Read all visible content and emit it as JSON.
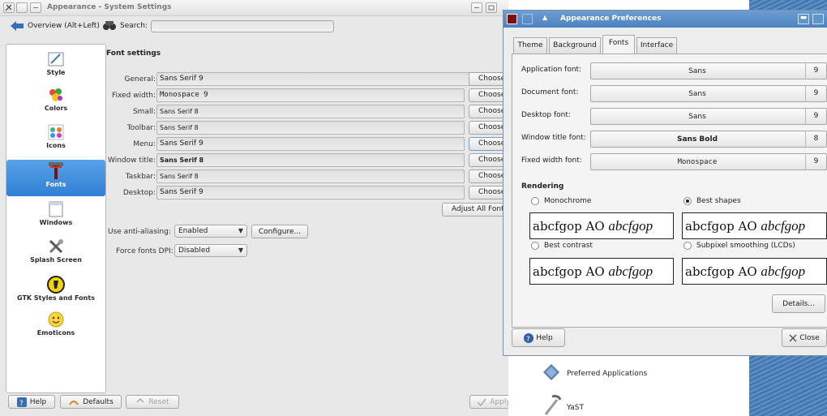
{
  "system_settings": {
    "window_title": "Appearance - System Settings",
    "toolbar": {
      "overview_label": "Overview (Alt+Left)",
      "search_label": "Search:",
      "search_value": ""
    },
    "sidebar": [
      {
        "label": "Style",
        "icon": "style-icon"
      },
      {
        "label": "Colors",
        "icon": "colors-icon"
      },
      {
        "label": "Icons",
        "icon": "icons-icon"
      },
      {
        "label": "Fonts",
        "icon": "fonts-icon",
        "selected": true
      },
      {
        "label": "Windows",
        "icon": "windows-icon"
      },
      {
        "label": "Splash Screen",
        "icon": "splash-screen-icon"
      },
      {
        "label": "GTK Styles and Fonts",
        "icon": "gtk-icon"
      },
      {
        "label": "Emoticons",
        "icon": "emoticons-icon"
      }
    ],
    "font_settings": {
      "title": "Font settings",
      "rows": [
        {
          "label": "General:",
          "value": "Sans Serif 9",
          "button": "Choose..."
        },
        {
          "label": "Fixed width:",
          "value": "Monospace 9",
          "button": "Choose..."
        },
        {
          "label": "Small:",
          "value": "Sans Serif 8",
          "button": "Choose..."
        },
        {
          "label": "Toolbar:",
          "value": "Sans Serif 8",
          "button": "Choose..."
        },
        {
          "label": "Menu:",
          "value": "Sans Serif 9",
          "button": "Choose..."
        },
        {
          "label": "Window title:",
          "value": "Sans Serif 8",
          "button": "Choose..."
        },
        {
          "label": "Taskbar:",
          "value": "Sans Serif 8",
          "button": "Choose..."
        },
        {
          "label": "Desktop:",
          "value": "Sans Serif 9",
          "button": "Choose..."
        }
      ],
      "adjust_all": "Adjust All Fonts...",
      "antialias_label": "Use anti-aliasing:",
      "antialias_value": "Enabled",
      "configure": "Configure...",
      "force_dpi_label": "Force fonts DPI:",
      "force_dpi_value": "Disabled"
    },
    "footer": {
      "help": "Help",
      "defaults": "Defaults",
      "reset": "Reset",
      "apply": "Apply"
    },
    "behind_items": {
      "preferred_apps": "Preferred Applications",
      "yast": "YaST"
    }
  },
  "appearance_prefs": {
    "window_title": "Appearance Preferences",
    "tabs": [
      "Theme",
      "Background",
      "Fonts",
      "Interface"
    ],
    "active_tab": "Fonts",
    "fonts": [
      {
        "label": "Application font:",
        "name": "Sans",
        "size": "9"
      },
      {
        "label": "Document font:",
        "name": "Sans",
        "size": "9"
      },
      {
        "label": "Desktop font:",
        "name": "Sans",
        "size": "9"
      },
      {
        "label": "Window title font:",
        "name": "Sans Bold",
        "size": "8"
      },
      {
        "label": "Fixed width font:",
        "name": "Monospace",
        "size": "9"
      }
    ],
    "rendering": {
      "title": "Rendering",
      "options": [
        {
          "label": "Monochrome",
          "selected": false
        },
        {
          "label": "Best shapes",
          "selected": true
        },
        {
          "label": "Best contrast",
          "selected": false
        },
        {
          "label": "Subpixel smoothing (LCDs)",
          "selected": false
        }
      ],
      "preview_plain": "abcfgop AO ",
      "preview_italic": "abcfgop"
    },
    "details": "Details...",
    "help": "Help",
    "close": "Close"
  },
  "colors": {
    "selection_blue": "#3a88dc",
    "title_blue": "#5a8fc9"
  }
}
